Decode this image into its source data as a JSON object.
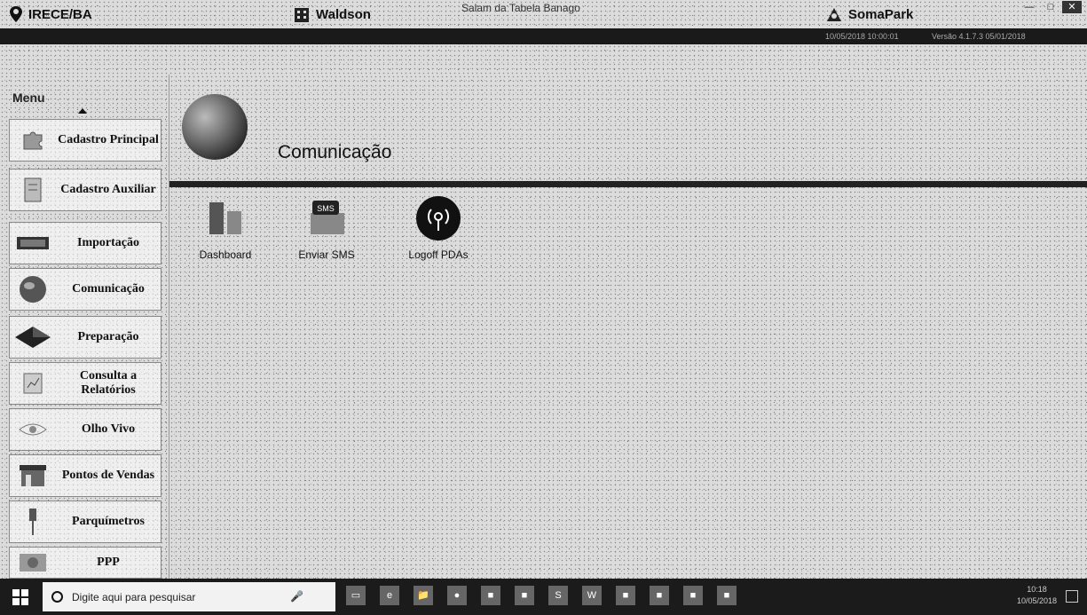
{
  "window": {
    "title": "Salam da Tabela Banago"
  },
  "header": {
    "location": "IRECE/BA",
    "user": "Waldson",
    "brand": "SomaPark"
  },
  "info_strip": {
    "left_text": "10/05/2018 10:00:01",
    "right_text": "Versão 4.1.7.3 05/01/2018"
  },
  "sidebar": {
    "menu_label": "Menu",
    "items": [
      {
        "label": "Cadastro Principal",
        "icon": "puzzle-icon"
      },
      {
        "label": "Cadastro Auxiliar",
        "icon": "document-icon"
      },
      {
        "label": "Importação",
        "icon": "import-icon"
      },
      {
        "label": "Comunicação",
        "icon": "globe-icon"
      },
      {
        "label": "Preparação",
        "icon": "diamond-icon"
      },
      {
        "label": "Consulta a Relatórios",
        "icon": "report-icon"
      },
      {
        "label": "Olho Vivo",
        "icon": "eye-icon"
      },
      {
        "label": "Pontos de Vendas",
        "icon": "store-icon"
      },
      {
        "label": "Parquímetros",
        "icon": "meter-icon"
      },
      {
        "label": "PPP",
        "icon": "ppp-icon"
      }
    ]
  },
  "main": {
    "title": "Comunicação",
    "apps": [
      {
        "label": "Dashboard",
        "icon": "dashboard-icon"
      },
      {
        "label": "Enviar SMS",
        "icon": "sms-icon",
        "badge": "SMS"
      },
      {
        "label": "Logoff PDAs",
        "icon": "signal-icon"
      }
    ]
  },
  "taskbar": {
    "search_placeholder": "Digite aqui para pesquisar",
    "time": "10:18",
    "date": "10/05/2018"
  }
}
